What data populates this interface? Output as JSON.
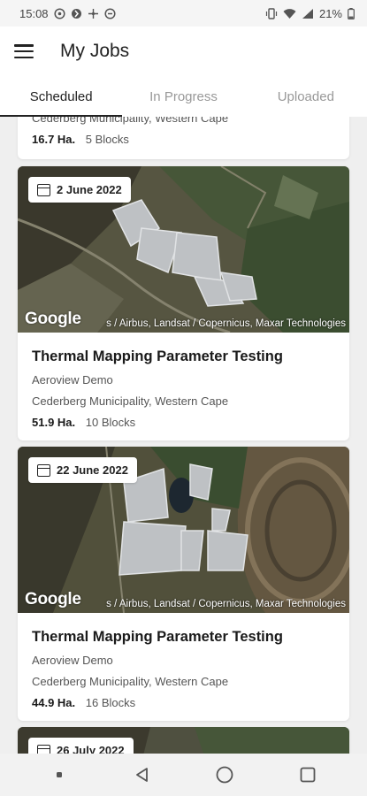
{
  "status_bar": {
    "time": "15:08",
    "battery": "21%"
  },
  "app_bar": {
    "title": "My Jobs",
    "menu_icon": "hamburger-menu-icon"
  },
  "tabs": [
    {
      "label": "Scheduled",
      "active": true
    },
    {
      "label": "In Progress",
      "active": false
    },
    {
      "label": "Uploaded",
      "active": false
    }
  ],
  "partial_card": {
    "location": "Cederberg Municipality, Western Cape",
    "hectares": "16.7 Ha.",
    "blocks": "5 Blocks"
  },
  "cards": [
    {
      "date": "2 June 2022",
      "title": "Thermal Mapping Parameter Testing",
      "client": "Aeroview Demo",
      "location": "Cederberg Municipality, Western Cape",
      "hectares": "51.9 Ha.",
      "blocks": "10 Blocks",
      "map_brand": "Google",
      "map_attribution": "s / Airbus, Landsat / Copernicus, Maxar Technologies"
    },
    {
      "date": "22 June 2022",
      "title": "Thermal Mapping Parameter Testing",
      "client": "Aeroview Demo",
      "location": "Cederberg Municipality, Western Cape",
      "hectares": "44.9 Ha.",
      "blocks": "16 Blocks",
      "map_brand": "Google",
      "map_attribution": "s / Airbus, Landsat / Copernicus, Maxar Technologies"
    }
  ],
  "next_card": {
    "date": "26 July 2022"
  },
  "colors": {
    "background": "#efefef",
    "card": "#ffffff",
    "active_tab": "#222222",
    "inactive_tab": "#999999"
  }
}
